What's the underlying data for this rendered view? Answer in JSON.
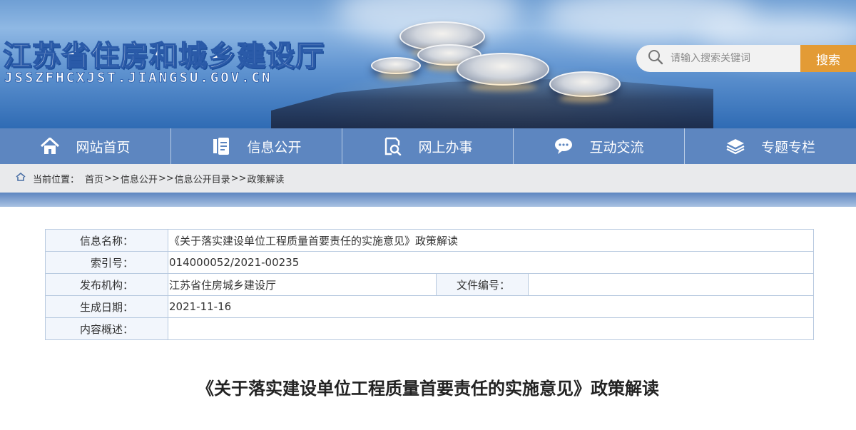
{
  "header": {
    "site_title": "江苏省住房和城乡建设厅",
    "site_domain": "JSSZFHCXJST.JIANGSU.GOV.CN"
  },
  "search": {
    "placeholder": "请输入搜索关键词",
    "button_label": "搜索"
  },
  "nav": {
    "items": [
      {
        "label": "网站首页",
        "icon": "home-icon"
      },
      {
        "label": "信息公开",
        "icon": "document-icon"
      },
      {
        "label": "网上办事",
        "icon": "search-document-icon"
      },
      {
        "label": "互动交流",
        "icon": "chat-icon"
      },
      {
        "label": "专题专栏",
        "icon": "layers-icon"
      }
    ]
  },
  "breadcrumb": {
    "prefix": "当前位置：",
    "items": [
      "首页",
      "信息公开",
      "信息公开目录",
      "政策解读"
    ],
    "separator": ">>"
  },
  "info_table": {
    "name_label": "信息名称：",
    "name_value": "《关于落实建设单位工程质量首要责任的实施意见》政策解读",
    "index_label": "索引号：",
    "index_value": "014000052/2021-00235",
    "publisher_label": "发布机构：",
    "publisher_value": "江苏省住房城乡建设厅",
    "doc_no_label": "文件编号：",
    "doc_no_value": "",
    "date_label": "生成日期：",
    "date_value": "2021-11-16",
    "summary_label": "内容概述：",
    "summary_value": ""
  },
  "article": {
    "title": "《关于落实建设单位工程质量首要责任的实施意见》政策解读"
  },
  "colors": {
    "nav_bg": "#5d86c0",
    "search_button": "#e39b35",
    "breadcrumb_bg": "#e9eaec",
    "table_border": "#b7c9df",
    "table_label_bg": "#f2f6fc"
  }
}
